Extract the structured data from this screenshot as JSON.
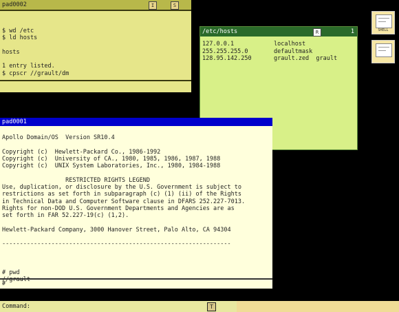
{
  "pad0002": {
    "title": "pad0002",
    "flag1": "I",
    "flag2": "S",
    "lines": [
      "$ wd /etc",
      "$ ld hosts",
      "",
      "hosts",
      "",
      "1 entry listed.",
      "$ cpscr //grault/dm"
    ]
  },
  "hosts_window": {
    "title": "/etc/hosts",
    "flag": "R",
    "window_number": "1",
    "rows": [
      {
        "ip": "127.0.0.1",
        "names": "localhost"
      },
      {
        "ip": "255.255.255.0",
        "names": "defaultmask"
      },
      {
        "ip": "128.95.142.250",
        "names": "grault.zed  grault"
      }
    ]
  },
  "pad0001": {
    "title": "pad0001",
    "lines": [
      "Apollo Domain/OS  Version SR10.4",
      "",
      "Copyright (c)  Hewlett-Packard Co., 1986-1992",
      "Copyright (c)  University of CA., 1980, 1985, 1986, 1987, 1988",
      "Copyright (c)  UNIX System Laboratories, Inc., 1980, 1984-1988",
      "",
      "                  RESTRICTED RIGHTS LEGEND",
      "Use, duplication, or disclosure by the U.S. Government is subject to",
      "restrictions as set forth in subparagraph (c) (1) (ii) of the Rights",
      "in Technical Data and Computer Software clause in DFARS 252.227-7013.",
      "Rights for non-DOD U.S. Government Departments and Agencies are as",
      "set forth in FAR 52.227-19(c) (1,2).",
      "",
      "Hewlett-Packard Company, 3000 Hanover Street, Palo Alto, CA 94304",
      "",
      "-----------------------------------------------------------------",
      "",
      "",
      "",
      "# pwd",
      "//grault"
    ],
    "input_prompt": "#"
  },
  "command_bar": {
    "label": "Command:",
    "button": "T"
  },
  "icons": [
    {
      "name": "icon-1",
      "label": "SHELL"
    },
    {
      "name": "icon-2",
      "label": ""
    }
  ]
}
